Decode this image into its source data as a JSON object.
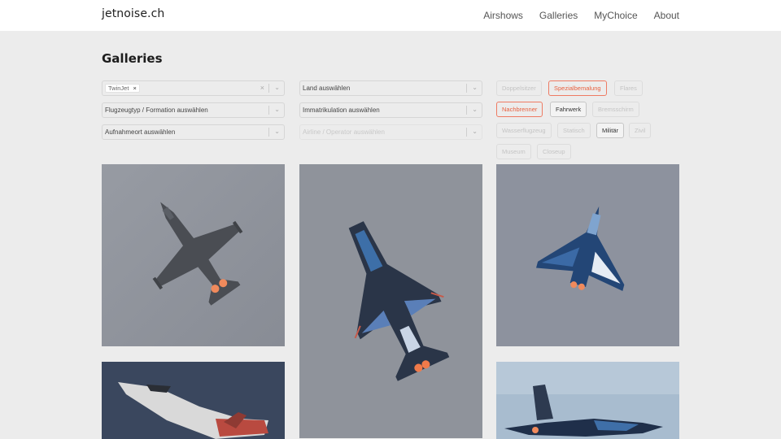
{
  "header": {
    "logo": "jetnoise.ch",
    "nav": [
      "Airshows",
      "Galleries",
      "MyChoice",
      "About"
    ]
  },
  "page": {
    "title": "Galleries"
  },
  "filters": {
    "aircraft_chip": "TwinJet",
    "clear_icon": "×",
    "chevron_icon": "⌄",
    "type_placeholder": "Flugzeugtyp / Formation auswählen",
    "location_placeholder": "Aufnahmeort auswählen",
    "country_placeholder": "Land auswählen",
    "registration_placeholder": "Immatrikulation auswählen",
    "airline_placeholder": "Airline / Operator auswählen"
  },
  "tags": [
    {
      "label": "Doppelsitzer",
      "state": "inactive"
    },
    {
      "label": "Spezialbemalung",
      "state": "selected"
    },
    {
      "label": "Flares",
      "state": "inactive"
    },
    {
      "label": "Nachbrenner",
      "state": "selected"
    },
    {
      "label": "Fahrwerk",
      "state": "available"
    },
    {
      "label": "Bremsschirm",
      "state": "inactive"
    },
    {
      "label": "Wasserflugzeug",
      "state": "inactive"
    },
    {
      "label": "Statisch",
      "state": "inactive"
    },
    {
      "label": "Militär",
      "state": "available"
    },
    {
      "label": "Zivil",
      "state": "inactive"
    },
    {
      "label": "Museum",
      "state": "inactive"
    },
    {
      "label": "Closeup",
      "state": "inactive"
    }
  ],
  "colors": {
    "accent": "#e8603f",
    "background": "#ececec",
    "header_bg": "#ffffff"
  }
}
